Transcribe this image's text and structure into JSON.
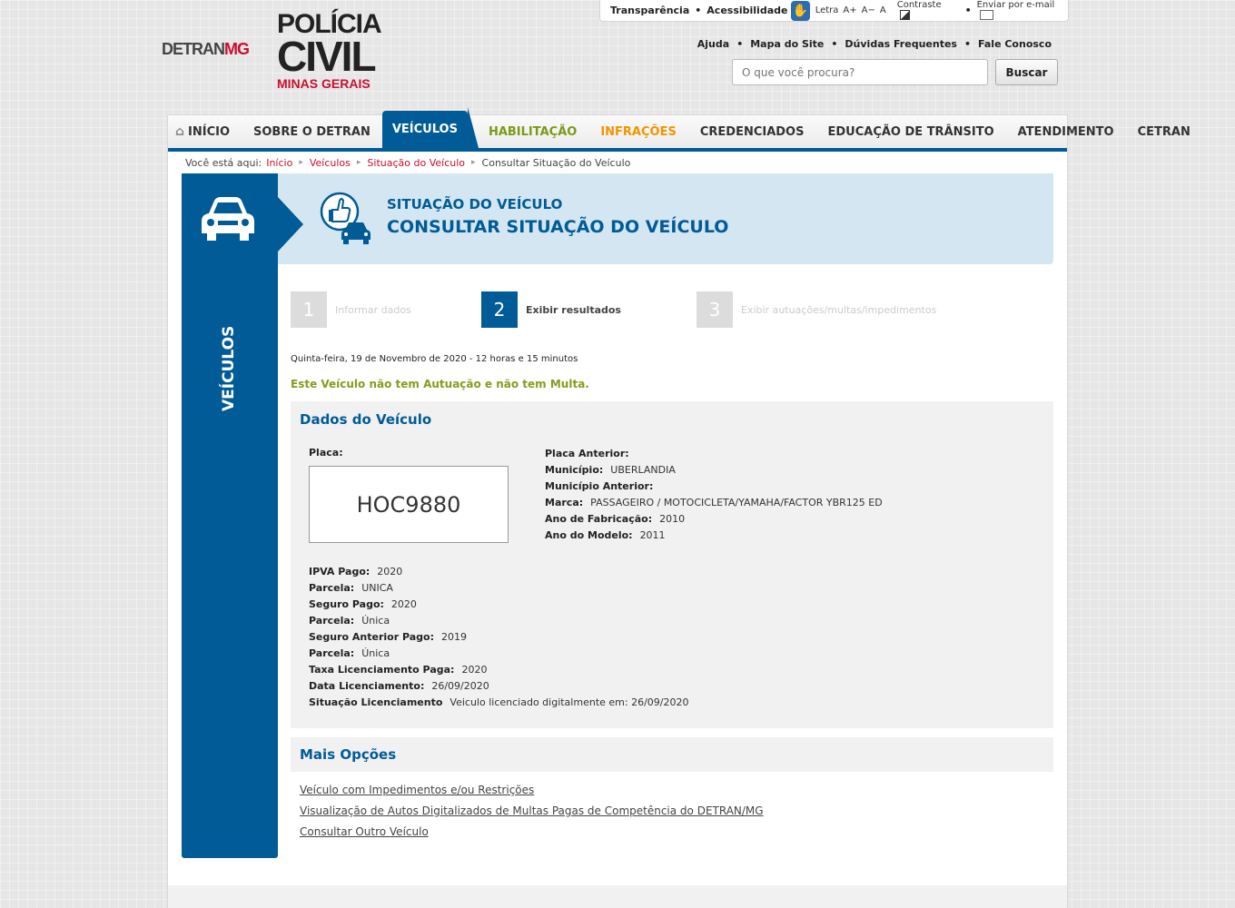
{
  "utility_bar": {
    "transparencia": "Transparência",
    "acessibilidade": "Acessibilidade",
    "letra_label": "Letra",
    "letra_plus": "A+",
    "letra_minus": "A−",
    "letra_reset": "A",
    "contraste": "Contraste",
    "email": "Enviar por e-mail"
  },
  "logos": {
    "detran_left": "DETRAN",
    "detran_right": "MG",
    "pc_line1": "POLÍCIA",
    "pc_line2": "CIVIL",
    "pc_line3": "MINAS GERAIS"
  },
  "header_links": [
    "Ajuda",
    "Mapa do Site",
    "Dúvidas Frequentes",
    "Fale Conosco"
  ],
  "search": {
    "placeholder": "O que você procura?",
    "button": "Buscar"
  },
  "nav": [
    "INÍCIO",
    "SOBRE O DETRAN",
    "VEÍCULOS",
    "HABILITAÇÃO",
    "INFRAÇÕES",
    "CREDENCIADOS",
    "EDUCAÇÃO DE TRÂNSITO",
    "ATENDIMENTO",
    "CETRAN"
  ],
  "breadcrumb": {
    "prefix": "Você está aqui:",
    "items": [
      "Início",
      "Veículos",
      "Situação do Veículo"
    ],
    "current": "Consultar Situação do Veículo"
  },
  "sidebar": {
    "label": "VEÍCULOS"
  },
  "title": {
    "line1": "SITUAÇÃO DO VEÍCULO",
    "line2": "CONSULTAR SITUAÇÃO DO VEÍCULO"
  },
  "steps": [
    {
      "num": "1",
      "label": "Informar dados"
    },
    {
      "num": "2",
      "label": "Exibir resultados"
    },
    {
      "num": "3",
      "label": "Exibir autuações/multas/impedimentos"
    }
  ],
  "date_line": "Quinta-feira, 19 de Novembro de 2020 - 12 horas e 15 minutos",
  "status_msg": "Este Veículo não tem Autuação e não tem Multa.",
  "vehicle": {
    "section_title": "Dados do Veículo",
    "plate_label": "Placa:",
    "plate": "HOC9880",
    "right_fields": [
      {
        "k": "Placa Anterior:",
        "v": ""
      },
      {
        "k": "Município:",
        "v": "UBERLANDIA"
      },
      {
        "k": "Município Anterior:",
        "v": ""
      },
      {
        "k": "Marca:",
        "v": "PASSAGEIRO / MOTOCICLETA/YAMAHA/FACTOR YBR125 ED"
      },
      {
        "k": "Ano de Fabricação:",
        "v": "2010"
      },
      {
        "k": "Ano do Modelo:",
        "v": "2011"
      }
    ],
    "bottom_fields": [
      {
        "k": "IPVA Pago:",
        "v": "2020"
      },
      {
        "k": "Parcela:",
        "v": "UNICA"
      },
      {
        "k": "Seguro Pago:",
        "v": "2020"
      },
      {
        "k": "Parcela:",
        "v": "Única"
      },
      {
        "k": "Seguro Anterior Pago:",
        "v": "2019"
      },
      {
        "k": "Parcela:",
        "v": "Única"
      },
      {
        "k": "Taxa Licenciamento Paga:",
        "v": "2020"
      },
      {
        "k": "Data Licenciamento:",
        "v": "26/09/2020"
      },
      {
        "k": "Situação Licenciamento",
        "v": "Veiculo licenciado digitalmente em: 26/09/2020"
      }
    ]
  },
  "more_options": {
    "title": "Mais Opções",
    "links": [
      "Veículo com Impedimentos e/ou Restrições",
      "Visualização de Autos Digitalizados de Multas Pagas de Competência do DETRAN/MG",
      "Consultar Outro Veículo"
    ]
  },
  "colors": {
    "primary": "#005b96",
    "red": "#c8102e",
    "green": "#7a9a16",
    "orange": "#f29400"
  }
}
